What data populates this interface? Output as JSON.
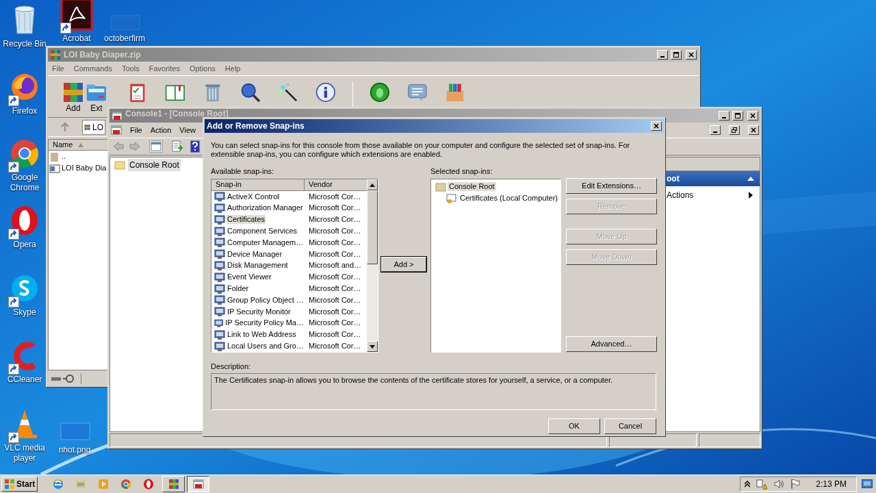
{
  "desktop_icons": [
    {
      "label": "Recycle Bin",
      "shortcut": false
    },
    {
      "label": "Firefox",
      "shortcut": true
    },
    {
      "label": "Google Chrome",
      "shortcut": true
    },
    {
      "label": "Opera",
      "shortcut": true
    },
    {
      "label": "Skype",
      "shortcut": true
    },
    {
      "label": "CCleaner",
      "shortcut": true
    },
    {
      "label": "VLC media player",
      "shortcut": true
    },
    {
      "label": "Acrobat",
      "shortcut": true
    },
    {
      "label": "octoberfirm",
      "shortcut": false
    },
    {
      "label": "nhot.png",
      "shortcut": false
    }
  ],
  "winrar": {
    "title": "LOI Baby Diaper.zip",
    "active": false,
    "menu": [
      "File",
      "Commands",
      "Tools",
      "Favorites",
      "Options",
      "Help"
    ],
    "toolbar_labels": [
      "Add",
      "Ext"
    ],
    "address": "LO",
    "file_list": {
      "columns": [
        "Name"
      ],
      "rows": [
        "..",
        "LOI Baby Dia"
      ]
    }
  },
  "console": {
    "title": "Console1 - [Console Root]",
    "active": false,
    "menu": [
      "File",
      "Action",
      "View"
    ],
    "tree": [
      {
        "label": "Console Root",
        "selected": true
      }
    ],
    "actions": {
      "header": "oot",
      "items": [
        "Actions"
      ]
    }
  },
  "dialog": {
    "title": "Add or Remove Snap-ins",
    "active": true,
    "intro": "You can select snap-ins for this console from those available on your computer and configure the selected set of snap-ins. For extensible snap-ins, you can configure which extensions are enabled.",
    "available_label": "Available snap-ins:",
    "available": {
      "columns": [
        "Snap-in",
        "Vendor"
      ],
      "rows": [
        {
          "name": "ActiveX Control",
          "vendor": "Microsoft Cor…",
          "selected": false
        },
        {
          "name": "Authorization Manager",
          "vendor": "Microsoft Cor…",
          "selected": false
        },
        {
          "name": "Certificates",
          "vendor": "Microsoft Cor…",
          "selected": true
        },
        {
          "name": "Component Services",
          "vendor": "Microsoft Cor…",
          "selected": false
        },
        {
          "name": "Computer Managem…",
          "vendor": "Microsoft Cor…",
          "selected": false
        },
        {
          "name": "Device Manager",
          "vendor": "Microsoft Cor…",
          "selected": false
        },
        {
          "name": "Disk Management",
          "vendor": "Microsoft and…",
          "selected": false
        },
        {
          "name": "Event Viewer",
          "vendor": "Microsoft Cor…",
          "selected": false
        },
        {
          "name": "Folder",
          "vendor": "Microsoft Cor…",
          "selected": false
        },
        {
          "name": "Group Policy Object …",
          "vendor": "Microsoft Cor…",
          "selected": false
        },
        {
          "name": "IP Security Monitor",
          "vendor": "Microsoft Cor…",
          "selected": false
        },
        {
          "name": "IP Security Policy Ma…",
          "vendor": "Microsoft Cor…",
          "selected": false
        },
        {
          "name": "Link to Web Address",
          "vendor": "Microsoft Cor…",
          "selected": false
        },
        {
          "name": "Local Users and Gro…",
          "vendor": "Microsoft Cor…",
          "selected": false
        }
      ]
    },
    "add_button": "Add >",
    "selected_label": "Selected snap-ins:",
    "selected_tree": [
      {
        "label": "Console Root",
        "selected": true,
        "children": [
          {
            "label": "Certificates (Local Computer)",
            "selected": false
          }
        ]
      }
    ],
    "side_buttons": [
      {
        "label": "Edit Extensions…",
        "disabled": false
      },
      {
        "label": "Remove",
        "disabled": true
      },
      {
        "label": "Move Up",
        "disabled": true
      },
      {
        "label": "Move Down",
        "disabled": true
      },
      {
        "label": "Advanced…",
        "disabled": false
      }
    ],
    "description_label": "Description:",
    "description": "The Certificates snap-in allows you to browse the contents of the certificate stores for yourself, a service, or a computer.",
    "buttons": [
      "OK",
      "Cancel"
    ]
  },
  "taskbar": {
    "start": "Start",
    "tasks": [
      {
        "selected": false
      },
      {
        "selected": true
      }
    ],
    "clock": "2:13 PM"
  }
}
